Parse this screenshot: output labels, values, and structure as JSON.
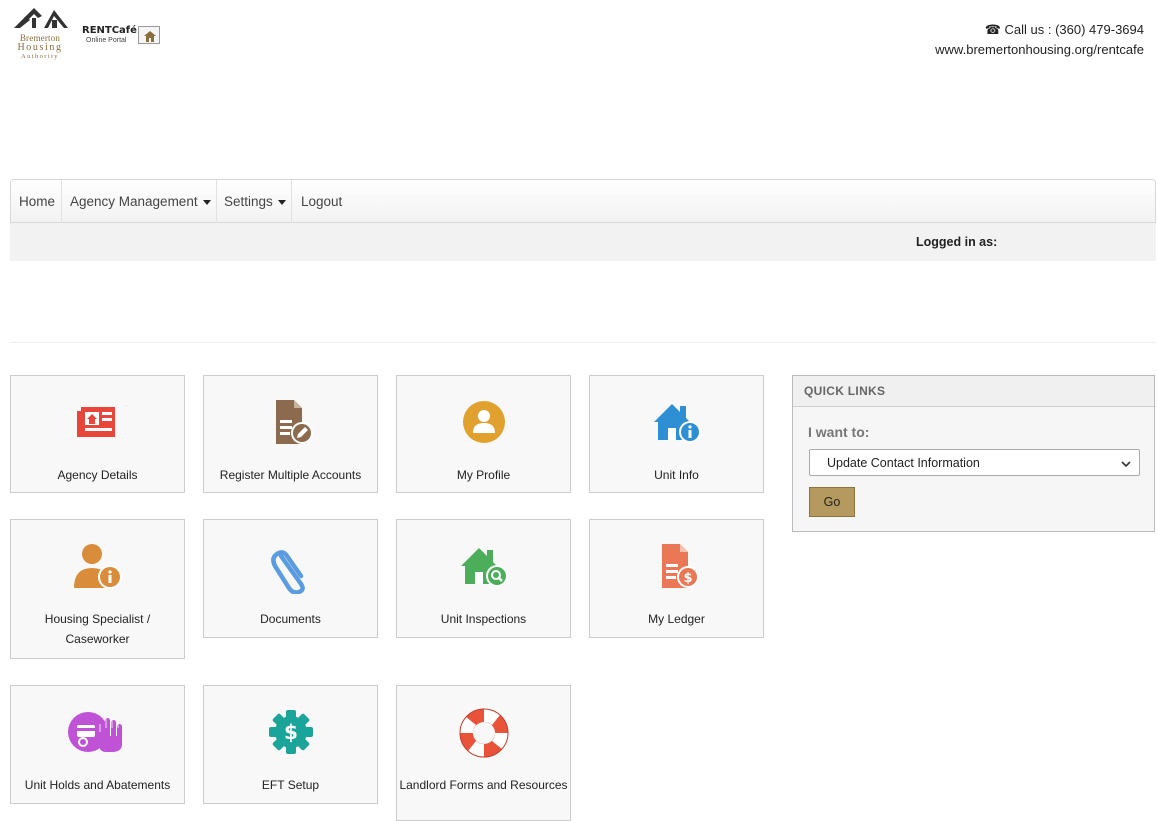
{
  "header": {
    "logo": {
      "line1": "Bremerton",
      "line2": "Housing",
      "line3": "Authority"
    },
    "rentcafe": {
      "brand": "RENTCafé",
      "sub": "Online Portal"
    },
    "phone": "Call us : (360) 479-3694",
    "website": "www.bremertonhousing.org/rentcafe"
  },
  "nav": {
    "home": "Home",
    "agency": "Agency Management",
    "settings": "Settings",
    "logout": "Logout",
    "logged_in": "Logged in as:"
  },
  "tiles": [
    {
      "label": "Agency Details",
      "icon": "agency-details-icon",
      "color": "#e8463a"
    },
    {
      "label": "Register Multiple Accounts",
      "icon": "register-accounts-icon",
      "color": "#8b6a4e"
    },
    {
      "label": "My Profile",
      "icon": "profile-icon",
      "color": "#e0a12f"
    },
    {
      "label": "Unit Info",
      "icon": "unit-info-icon",
      "color": "#2e8fd4"
    },
    {
      "label": "Housing Specialist / Caseworker",
      "icon": "caseworker-icon",
      "color": "#d98c3a"
    },
    {
      "label": "Documents",
      "icon": "paperclip-icon",
      "color": "#5b9be0"
    },
    {
      "label": "Unit Inspections",
      "icon": "unit-inspections-icon",
      "color": "#4cae5a"
    },
    {
      "label": "My Ledger",
      "icon": "ledger-icon",
      "color": "#ea7755"
    },
    {
      "label": "Unit Holds and Abatements",
      "icon": "unit-holds-icon",
      "color": "#c052d6"
    },
    {
      "label": "EFT Setup",
      "icon": "eft-gear-icon",
      "color": "#1ba59a"
    },
    {
      "label": "Landlord Forms and Resources",
      "icon": "lifebuoy-icon",
      "color": "#e8533a"
    }
  ],
  "quick_links": {
    "title": "QUICK LINKS",
    "want": "I want to:",
    "selected": "Update Contact Information",
    "go": "Go"
  }
}
